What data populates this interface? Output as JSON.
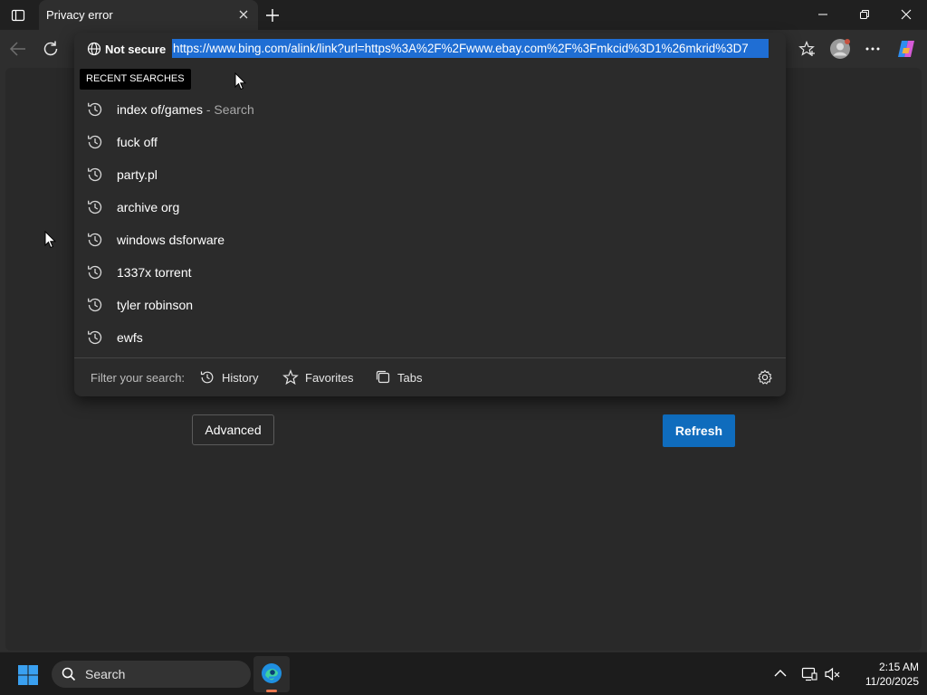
{
  "browser": {
    "tab_title": "Privacy error",
    "security_label": "Not secure",
    "url": "https://www.bing.com/alink/link?url=https%3A%2F%2Fwww.ebay.com%2F%3Fmkcid%3D1%26mkrid%3D7"
  },
  "omnibox": {
    "section_label": "RECENT SEARCHES",
    "suggestions": [
      {
        "text": "index of/games",
        "hint": " - Search"
      },
      {
        "text": "fuck off",
        "hint": ""
      },
      {
        "text": "party.pl",
        "hint": ""
      },
      {
        "text": "archive org",
        "hint": ""
      },
      {
        "text": "windows dsforware",
        "hint": ""
      },
      {
        "text": "1337x torrent",
        "hint": ""
      },
      {
        "text": "tyler robinson",
        "hint": ""
      },
      {
        "text": "ewfs",
        "hint": ""
      }
    ],
    "filter_label": "Filter your search:",
    "filters": [
      "History",
      "Favorites",
      "Tabs"
    ]
  },
  "page": {
    "advanced_label": "Advanced",
    "refresh_label": "Refresh"
  },
  "taskbar": {
    "search_label": "Search",
    "time": "2:15 AM",
    "date": "11/20/2025"
  },
  "colors": {
    "accent": "#0f6cbd",
    "url_highlight": "#1f6ed4",
    "edge_indicator": "#e8774f"
  }
}
